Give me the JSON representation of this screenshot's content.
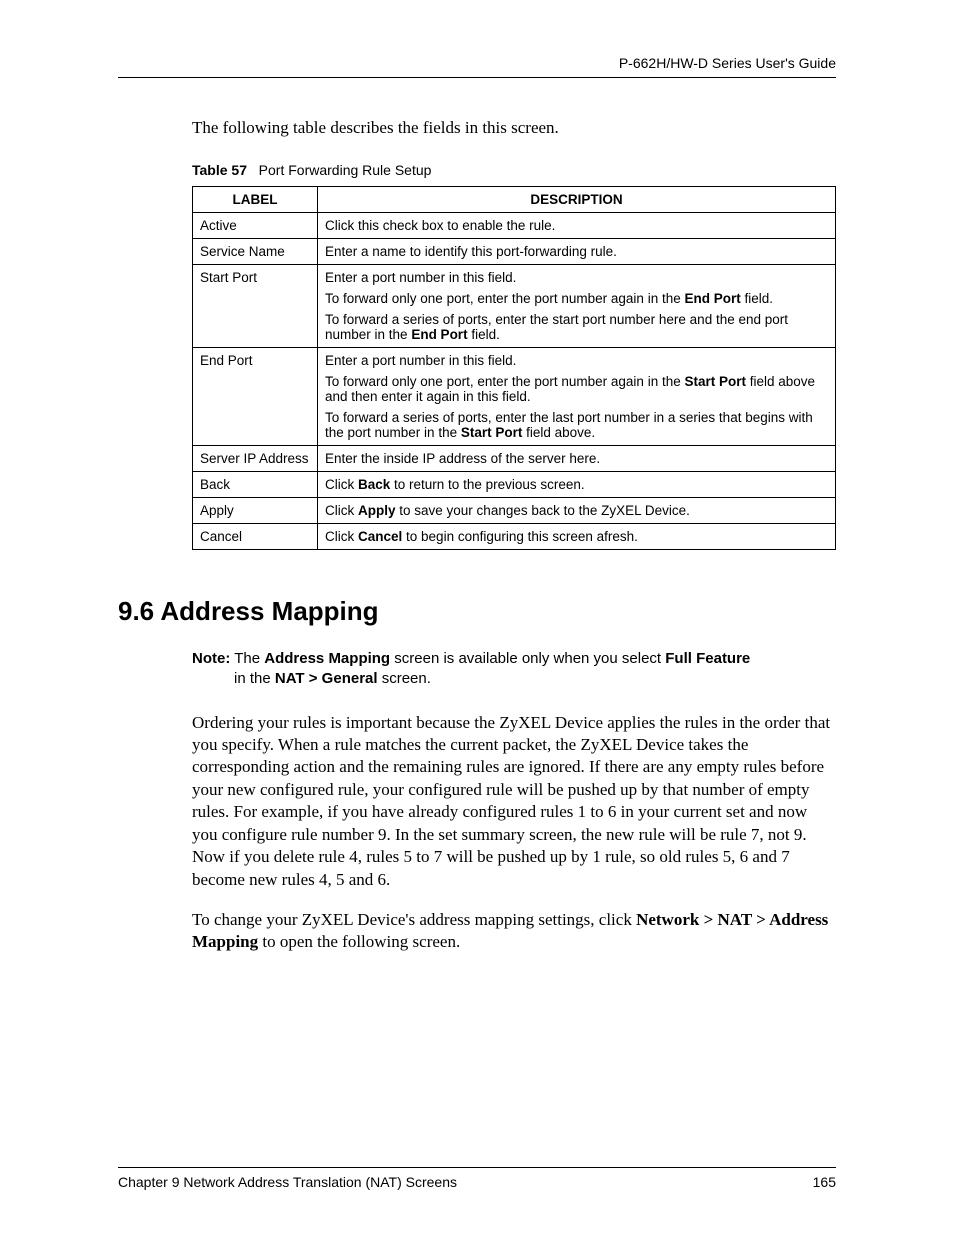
{
  "header": {
    "guide_title": "P-662H/HW-D Series User's Guide"
  },
  "intro": "The following table describes the fields in this screen.",
  "table_caption": {
    "label": "Table 57",
    "title": "Port Forwarding Rule Setup"
  },
  "table": {
    "headers": {
      "col1": "LABEL",
      "col2": "DESCRIPTION"
    },
    "rows": {
      "r0": {
        "label": "Active",
        "desc_html": "Click this check box to enable the rule."
      },
      "r1": {
        "label": "Service Name",
        "desc_html": "Enter a name to identify this port-forwarding rule."
      },
      "r2": {
        "label": "Start Port",
        "p1": "Enter a port number in this field.",
        "p2_a": "To forward only one port, enter the port number again in the ",
        "p2_b": "End Port",
        "p2_c": " field.",
        "p3_a": "To forward a series of ports, enter the start port number here and the end port number in the ",
        "p3_b": "End Port",
        "p3_c": " field."
      },
      "r3": {
        "label": "End Port",
        "p1": "Enter a port number in this field.",
        "p2_a": "To forward only one port, enter the port number again in the ",
        "p2_b": "Start Port",
        "p2_c": " field above and then enter it again in this field.",
        "p3_a": "To forward a series of ports, enter the last port number in a series that begins with the port number in the ",
        "p3_b": "Start Port",
        "p3_c": " field above."
      },
      "r4": {
        "label": "Server IP Address",
        "desc_html": "Enter the inside IP address of the server here."
      },
      "r5": {
        "label": "Back",
        "a": "Click ",
        "b": "Back",
        "c": " to return to the previous screen."
      },
      "r6": {
        "label": "Apply",
        "a": "Click ",
        "b": "Apply",
        "c": " to save your changes back to the ZyXEL Device."
      },
      "r7": {
        "label": "Cancel",
        "a": "Click ",
        "b": "Cancel",
        "c": " to begin configuring this screen afresh."
      }
    }
  },
  "section": {
    "heading": "9.6  Address Mapping"
  },
  "note": {
    "label": "Note:",
    "t1": " The ",
    "b1": "Address Mapping",
    "t2": " screen is available only when you select ",
    "b2": "Full Feature",
    "t3_line2_a": "in the ",
    "b3": "NAT > General",
    "t3_line2_b": " screen."
  },
  "body": {
    "p1": "Ordering your rules is important because the ZyXEL Device applies the rules in the order that you specify. When a rule matches the current packet, the ZyXEL Device takes the corresponding action and the remaining rules are ignored. If there are any empty rules before your new configured rule, your configured rule will be pushed up by that number of empty rules. For example, if you have already configured rules 1 to 6 in your current set and now you configure rule number 9. In the set summary screen, the new rule will be rule 7, not 9. Now if you delete rule 4, rules 5 to 7 will be pushed up by 1 rule, so old rules 5, 6 and 7 become new rules 4, 5 and 6.",
    "p2_a": "To change your ZyXEL Device's address mapping settings, click ",
    "p2_b": "Network > NAT > Address Mapping",
    "p2_c": " to open the following screen."
  },
  "footer": {
    "chapter": "Chapter 9 Network Address Translation (NAT) Screens",
    "page": "165"
  }
}
